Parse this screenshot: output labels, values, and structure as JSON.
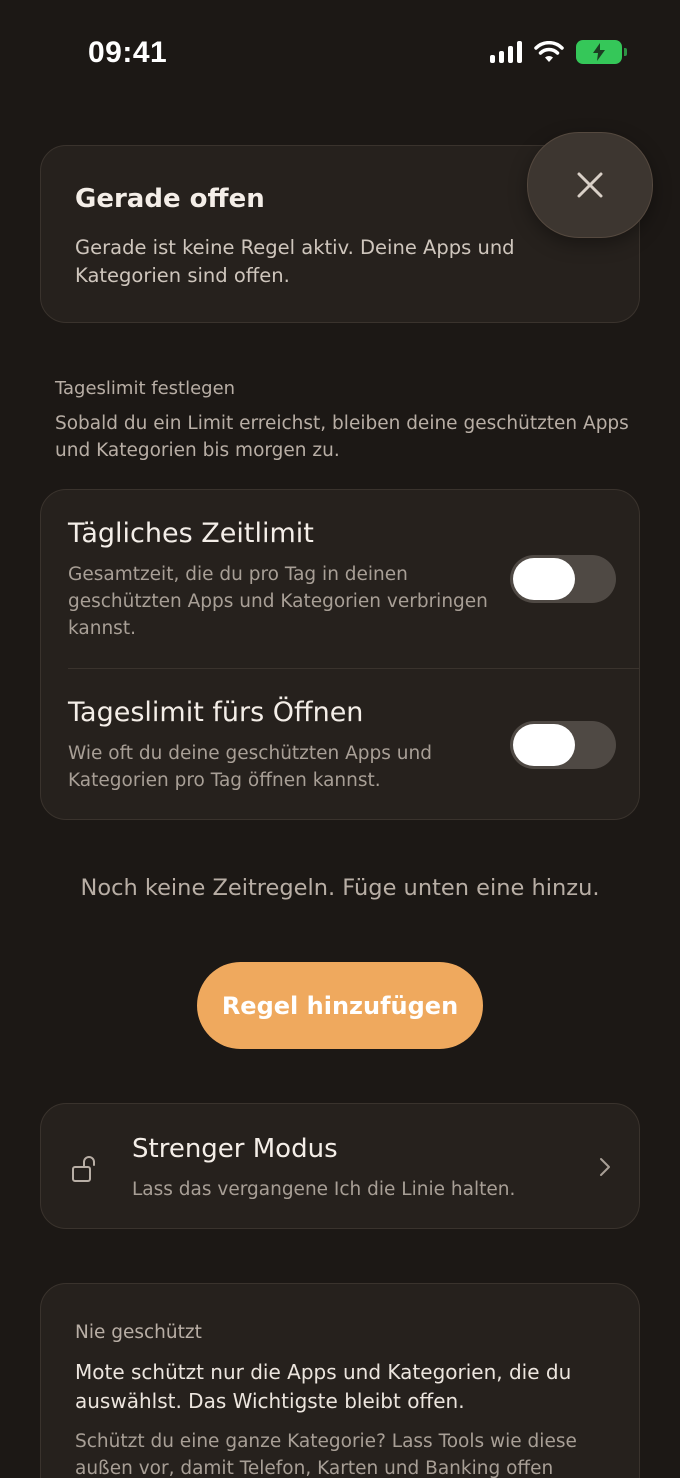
{
  "status_bar": {
    "time": "09:41",
    "icons": [
      "cellular-signal-icon",
      "wifi-icon",
      "battery-charging-icon"
    ],
    "battery_color": "#35c759"
  },
  "open_card": {
    "title": "Gerade offen",
    "description": "Gerade ist keine Regel aktiv. Deine Apps und Kategorien sind offen.",
    "close_icon": "close-icon"
  },
  "daily_limit_section": {
    "label": "Tageslimit festlegen",
    "description": "Sobald du ein Limit erreichst, bleiben deine geschützten Apps und Kategorien bis morgen zu."
  },
  "limits": [
    {
      "title": "Tägliches Zeitlimit",
      "description": "Gesamtzeit, die du pro Tag in deinen geschützten Apps und Kategorien verbringen kannst.",
      "enabled": false
    },
    {
      "title": "Tageslimit fürs Öffnen",
      "description": "Wie oft du deine geschützten Apps und Kategorien pro Tag öffnen kannst.",
      "enabled": false
    }
  ],
  "rules": {
    "empty_text": "Noch keine Zeitregeln. Füge unten eine hinzu.",
    "add_button_label": "Regel hinzufügen",
    "accent_color": "#efa95e"
  },
  "strict_mode": {
    "title": "Strenger Modus",
    "subtitle": "Lass das vergangene Ich die Linie halten.",
    "icon": "unlocked-padlock-icon"
  },
  "never_protected": {
    "label": "Nie geschützt",
    "text": "Mote schützt nur die Apps und Kategorien, die du auswählst. Das Wichtigste bleibt offen.",
    "note": "Schützt du eine ganze Kategorie? Lass Tools wie diese außen vor, damit Telefon, Karten und Banking offen"
  }
}
